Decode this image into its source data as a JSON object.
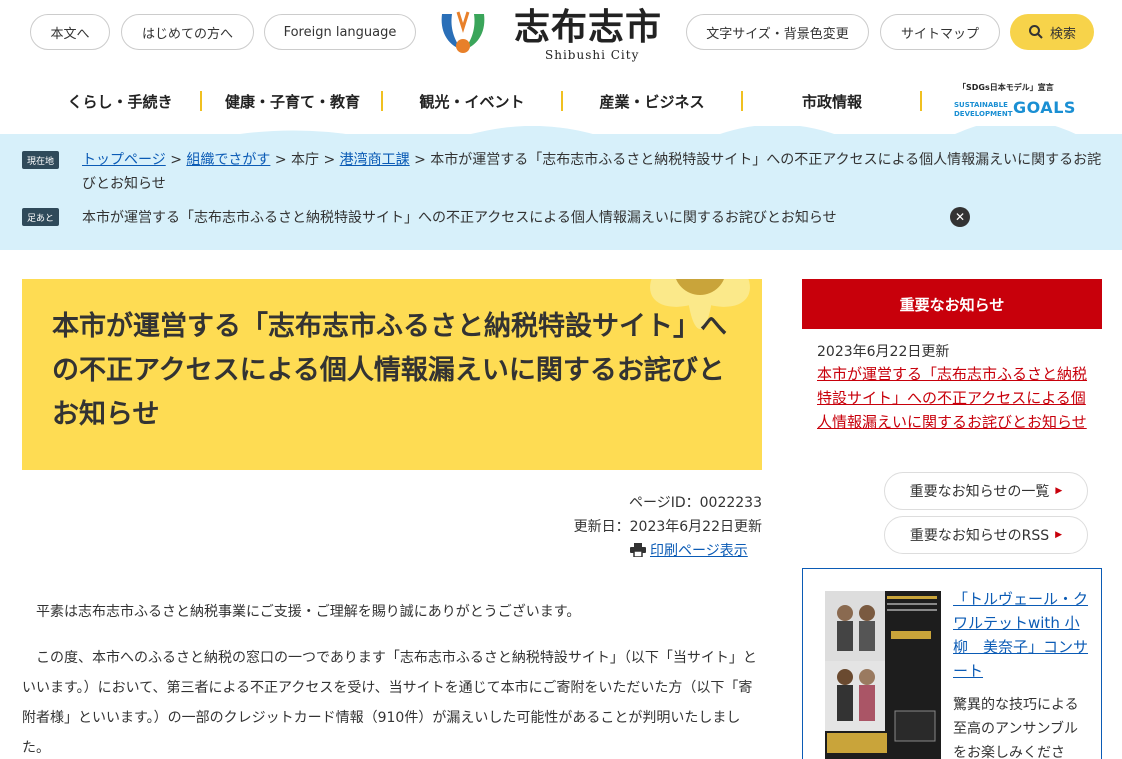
{
  "header": {
    "skip_to_content": "本文へ",
    "first_time": "はじめての方へ",
    "foreign_language": "Foreign language",
    "site_title": "志布志市",
    "site_title_en": "Shibushi City",
    "text_size_color": "文字サイズ・背景色変更",
    "sitemap": "サイトマップ",
    "search": "検索"
  },
  "nav": {
    "items": [
      {
        "label": "くらし・手続き"
      },
      {
        "label": "健康・子育て・教育"
      },
      {
        "label": "観光・イベント"
      },
      {
        "label": "産業・ビジネス"
      },
      {
        "label": "市政情報"
      }
    ],
    "sdgs_declaration": "「SDGs日本モデル」宣言",
    "sdgs_sustainable": "SUSTAINABLE",
    "sdgs_development": "DEVELOPMENT",
    "sdgs_goals": "GOALS"
  },
  "breadcrumb": {
    "current_tag": "現在地",
    "links": [
      "トップページ",
      "組織でさがす"
    ],
    "sep": ">",
    "plain": "本庁",
    "link3": "港湾商工課",
    "current": "本市が運営する「志布志市ふるさと納税特設サイト」への不正アクセスによる個人情報漏えいに関するお詫びとお知らせ"
  },
  "footprint": {
    "tag": "足あと",
    "text": "本市が運営する「志布志市ふるさと納税特設サイト」への不正アクセスによる個人情報漏えいに関するお詫びとお知らせ",
    "close": "✕"
  },
  "article": {
    "title": "本市が運営する「志布志市ふるさと納税特設サイト」への不正アクセスによる個人情報漏えいに関するお詫びとお知らせ",
    "page_id": "ページID：0022233",
    "updated": "更新日：2023年6月22日更新",
    "print": "印刷ページ表示",
    "paragraph1": "平素は志布志市ふるさと納税事業にご支援・ご理解を賜り誠にありがとうございます。",
    "paragraph2": "この度、本市へのふるさと納税の窓口の一つであります「志布志市ふるさと納税特設サイト」（以下「当サイト」といいます。）において、第三者による不正アクセスを受け、当サイトを通じて本市にご寄附をいただいた方（以下「寄附者様」といいます。）の一部のクレジットカード情報（910件）が漏えいした可能性があることが判明いたしました。"
  },
  "sidebar": {
    "notice_heading": "重要なお知らせ",
    "notice_date": "2023年6月22日更新",
    "notice_link": "本市が運営する「志布志市ふるさと納税特設サイト」への不正アクセスによる個人情報漏えいに関するお詫びとお知らせ",
    "list_button": "重要なお知らせの一覧",
    "rss_button": "重要なお知らせのRSS",
    "banner_link": "「トルヴェール・クワルテットwith 小柳　美奈子」コンサート",
    "banner_desc": "驚異的な技巧による至高のアンサンブルをお楽しみくださ"
  },
  "colors": {
    "accent_yellow": "#fedc53",
    "notice_red": "#c8000b",
    "band_blue": "#d7f0fa",
    "link_blue": "#0b5bb5"
  }
}
